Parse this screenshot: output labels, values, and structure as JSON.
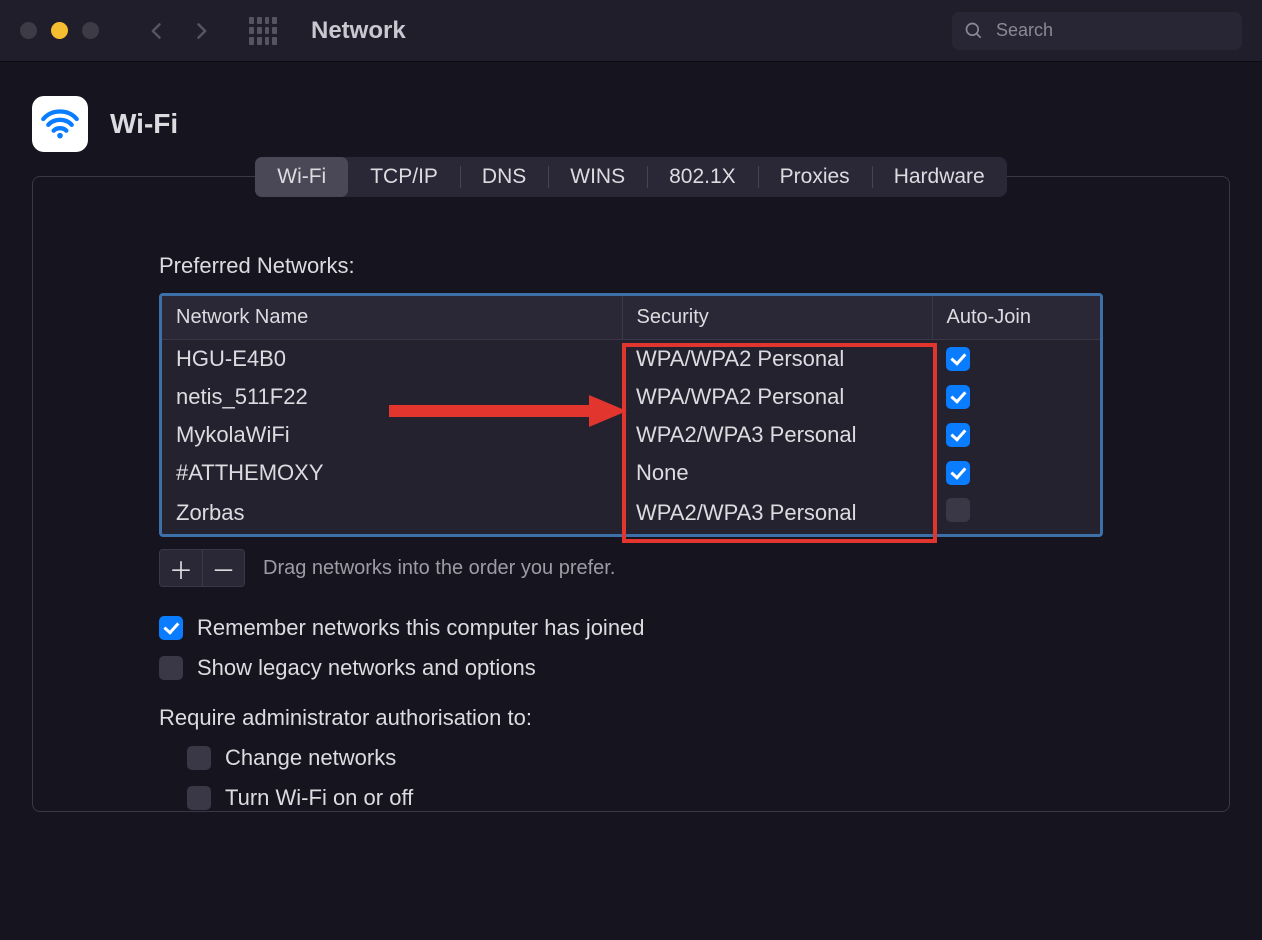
{
  "titlebar": {
    "title": "Network",
    "search_placeholder": "Search"
  },
  "page": {
    "title": "Wi-Fi"
  },
  "tabs": [
    "Wi-Fi",
    "TCP/IP",
    "DNS",
    "WINS",
    "802.1X",
    "Proxies",
    "Hardware"
  ],
  "selected_tab": 0,
  "table": {
    "label": "Preferred Networks:",
    "columns": [
      "Network Name",
      "Security",
      "Auto-Join"
    ],
    "rows": [
      {
        "name": "HGU-E4B0",
        "security": "WPA/WPA2 Personal",
        "auto": true
      },
      {
        "name": "netis_511F22",
        "security": "WPA/WPA2 Personal",
        "auto": true
      },
      {
        "name": "MykolaWiFi",
        "security": "WPA2/WPA3 Personal",
        "auto": true
      },
      {
        "name": "#ATTHEMOXY",
        "security": "None",
        "auto": true
      },
      {
        "name": "Zorbas",
        "security": "WPA2/WPA3 Personal",
        "auto": false
      }
    ],
    "hint": "Drag networks into the order you prefer."
  },
  "options": {
    "remember": {
      "label": "Remember networks this computer has joined",
      "checked": true
    },
    "legacy": {
      "label": "Show legacy networks and options",
      "checked": false
    },
    "require_label": "Require administrator authorisation to:",
    "change_networks": {
      "label": "Change networks",
      "checked": false
    },
    "turn_wifi": {
      "label": "Turn Wi-Fi on or off",
      "checked": false
    }
  }
}
